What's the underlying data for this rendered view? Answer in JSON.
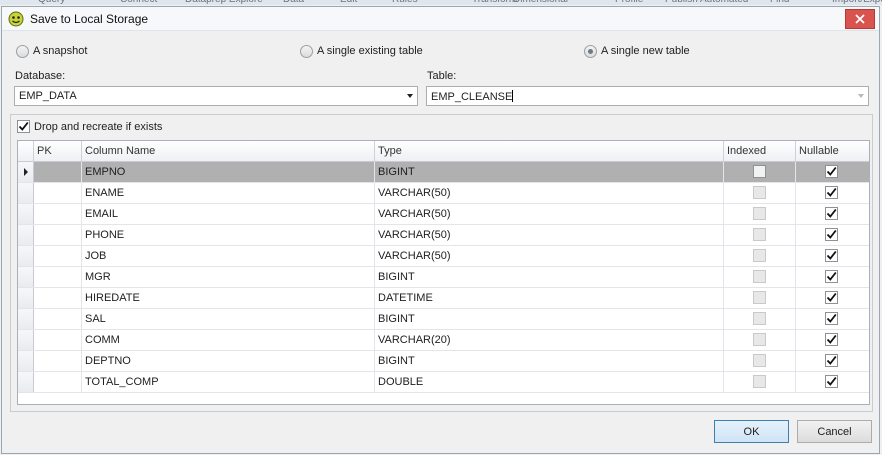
{
  "background_menu": [
    "Query",
    "Connect",
    "Dataprep Explore",
    "Data",
    "Edit",
    "Rules",
    "Transform",
    "Dimensional",
    "Profile",
    "Publish",
    "Automated",
    "Find",
    "Import/Export"
  ],
  "dialog": {
    "title": "Save to Local Storage",
    "close_icon": "close-icon",
    "accent_close": "#d9534f"
  },
  "save_mode": {
    "options": [
      {
        "label": "A snapshot",
        "checked": false
      },
      {
        "label": "A single existing table",
        "checked": false
      },
      {
        "label": "A single new table",
        "checked": true
      }
    ]
  },
  "database": {
    "label": "Database:",
    "value": "EMP_DATA"
  },
  "table": {
    "label": "Table:",
    "value": "EMP_CLEANSE"
  },
  "drop_recreate": {
    "label": "Drop and recreate if exists",
    "checked": true
  },
  "grid": {
    "columns": [
      "PK",
      "Column Name",
      "Type",
      "Indexed",
      "Nullable"
    ],
    "rows": [
      {
        "name": "EMPNO",
        "type": "BIGINT",
        "indexed": false,
        "nullable": true,
        "selected": true
      },
      {
        "name": "ENAME",
        "type": "VARCHAR(50)",
        "indexed": false,
        "nullable": true
      },
      {
        "name": "EMAIL",
        "type": "VARCHAR(50)",
        "indexed": false,
        "nullable": true
      },
      {
        "name": "PHONE",
        "type": "VARCHAR(50)",
        "indexed": false,
        "nullable": true
      },
      {
        "name": "JOB",
        "type": "VARCHAR(50)",
        "indexed": false,
        "nullable": true
      },
      {
        "name": "MGR",
        "type": "BIGINT",
        "indexed": false,
        "nullable": true
      },
      {
        "name": "HIREDATE",
        "type": "DATETIME",
        "indexed": false,
        "nullable": true
      },
      {
        "name": "SAL",
        "type": "BIGINT",
        "indexed": false,
        "nullable": true
      },
      {
        "name": "COMM",
        "type": "VARCHAR(20)",
        "indexed": false,
        "nullable": true
      },
      {
        "name": "DEPTNO",
        "type": "BIGINT",
        "indexed": false,
        "nullable": true
      },
      {
        "name": "TOTAL_COMP",
        "type": "DOUBLE",
        "indexed": false,
        "nullable": true
      }
    ]
  },
  "buttons": {
    "ok": "OK",
    "cancel": "Cancel"
  }
}
